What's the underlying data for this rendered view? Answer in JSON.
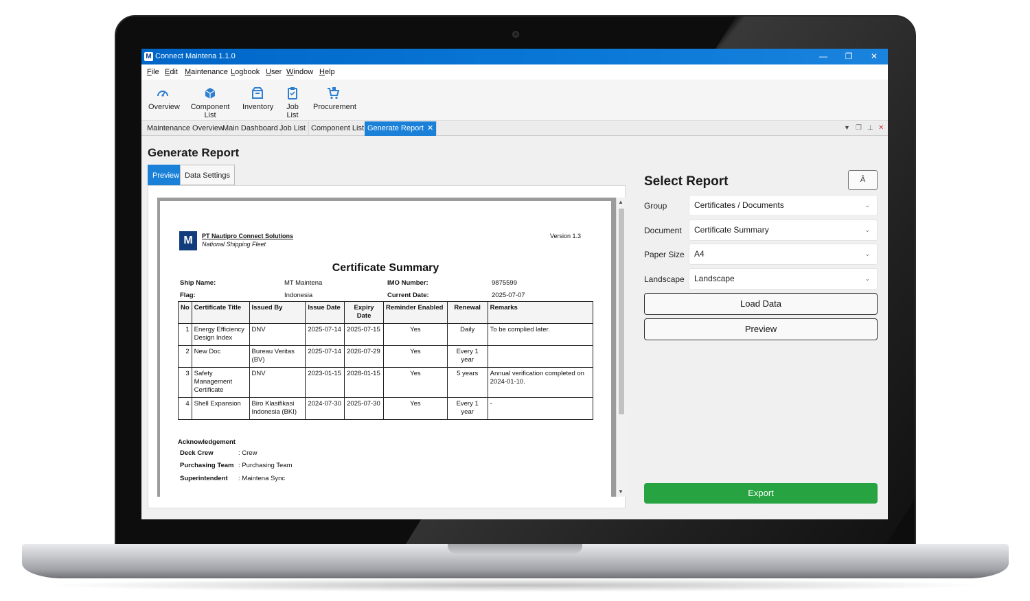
{
  "app": {
    "logo_letter": "M",
    "title": "Connect Maintena 1.1.0",
    "window_controls": [
      "—",
      "❐",
      "✕"
    ]
  },
  "menu": [
    "File",
    "Edit",
    "Maintenance",
    "Logbook",
    "User",
    "Window",
    "Help"
  ],
  "toolbar": [
    {
      "label": "Overview",
      "icon": "gauge-icon"
    },
    {
      "label": "Component List",
      "icon": "cube-icon"
    },
    {
      "label": "Inventory",
      "icon": "inventory-box-icon"
    },
    {
      "label": "Job List",
      "icon": "clipboard-icon"
    },
    {
      "label": "Procurement",
      "icon": "cart-icon"
    }
  ],
  "doc_tabs": [
    {
      "label": "Maintenance Overview",
      "active": false
    },
    {
      "label": "Main Dashboard",
      "active": false
    },
    {
      "label": "Job List",
      "active": false
    },
    {
      "label": "Component List",
      "active": false
    },
    {
      "label": "Generate Report",
      "active": true
    }
  ],
  "page_title": "Generate Report",
  "subtabs": [
    {
      "label": "Preview",
      "active": true
    },
    {
      "label": "Data Settings",
      "active": false
    }
  ],
  "report": {
    "company_letter": "M",
    "company_name": "PT Nautipro Connect Solutions",
    "company_sub": "National Shipping Fleet",
    "version": "Version 1.3",
    "title": "Certificate Summary",
    "ship_name_label": "Ship Name:",
    "ship_name": "MT Maintena",
    "imo_label": "IMO Number:",
    "imo": "9875599",
    "flag_label": "Flag:",
    "flag": "Indonesia",
    "current_date_label": "Current Date:",
    "current_date": "2025-07-07",
    "columns": [
      "No",
      "Certificate Title",
      "Issued By",
      "Issue Date",
      "Expiry Date",
      "Reminder Enabled",
      "Renewal",
      "Remarks"
    ],
    "rows": [
      [
        "1",
        "Energy Efficiency Design Index",
        "DNV",
        "2025-07-14",
        "2025-07-15",
        "Yes",
        "Daily",
        "To be complied later."
      ],
      [
        "2",
        "New Doc",
        "Bureau Veritas (BV)",
        "2025-07-14",
        "2026-07-29",
        "Yes",
        "Every 1 year",
        ""
      ],
      [
        "3",
        "Safety Management Certificate",
        "DNV",
        "2023-01-15",
        "2028-01-15",
        "Yes",
        "5 years",
        "Annual verification completed on 2024-01-10."
      ],
      [
        "4",
        "Shell Expansion",
        "Biro Klasifikasi Indonesia (BKI)",
        "2024-07-30",
        "2025-07-30",
        "Yes",
        "Every 1 year",
        "-"
      ]
    ],
    "ack_title": "Acknowledgement",
    "ack": [
      {
        "label": "Deck Crew",
        "value": ": Crew"
      },
      {
        "label": "Purchasing Team",
        "value": ": Purchasing Team"
      },
      {
        "label": "Superintendent",
        "value": ": Maintena Sync"
      }
    ]
  },
  "panel": {
    "title": "Select Report",
    "font_button": "Â",
    "fields": [
      {
        "label": "Group",
        "value": "Certificates / Documents"
      },
      {
        "label": "Document",
        "value": "Certificate Summary"
      },
      {
        "label": "Paper Size",
        "value": "A4"
      },
      {
        "label": "Landscape",
        "value": "Landscape"
      }
    ],
    "load_button": "Load Data",
    "preview_button": "Preview",
    "export_button": "Export"
  },
  "colors": {
    "title_bar": "#0a78d7",
    "active_tab": "#1a80d8",
    "export": "#27a342"
  }
}
